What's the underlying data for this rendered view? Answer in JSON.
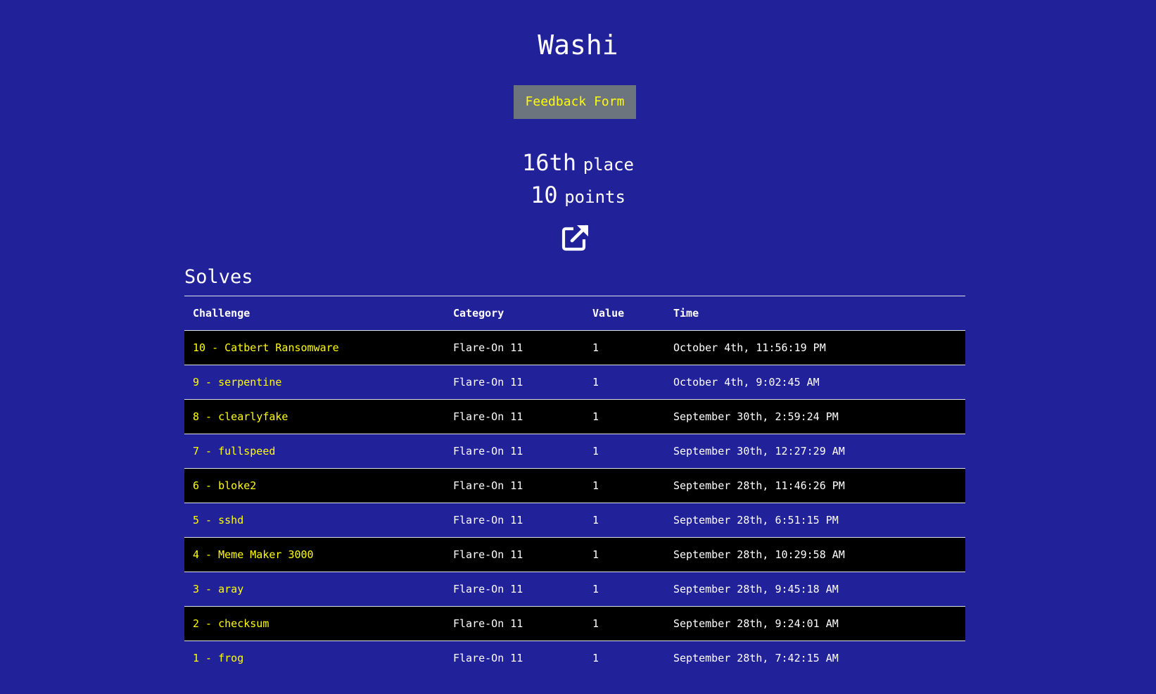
{
  "header": {
    "title": "Washi",
    "feedback_label": "Feedback Form"
  },
  "stats": {
    "place_value": "16th",
    "place_label": "place",
    "points_value": "10",
    "points_label": "points"
  },
  "icons": {
    "edit": "external-link-icon"
  },
  "solves": {
    "heading": "Solves",
    "columns": [
      "Challenge",
      "Category",
      "Value",
      "Time"
    ],
    "rows": [
      {
        "challenge": "10 - Catbert Ransomware",
        "category": "Flare-On 11",
        "value": "1",
        "time": "October 4th, 11:56:19 PM"
      },
      {
        "challenge": "9 - serpentine",
        "category": "Flare-On 11",
        "value": "1",
        "time": "October 4th, 9:02:45 AM"
      },
      {
        "challenge": "8 - clearlyfake",
        "category": "Flare-On 11",
        "value": "1",
        "time": "September 30th, 2:59:24 PM"
      },
      {
        "challenge": "7 - fullspeed",
        "category": "Flare-On 11",
        "value": "1",
        "time": "September 30th, 12:27:29 AM"
      },
      {
        "challenge": "6 - bloke2",
        "category": "Flare-On 11",
        "value": "1",
        "time": "September 28th, 11:46:26 PM"
      },
      {
        "challenge": "5 - sshd",
        "category": "Flare-On 11",
        "value": "1",
        "time": "September 28th, 6:51:15 PM"
      },
      {
        "challenge": "4 - Meme Maker 3000",
        "category": "Flare-On 11",
        "value": "1",
        "time": "September 28th, 10:29:58 AM"
      },
      {
        "challenge": "3 - aray",
        "category": "Flare-On 11",
        "value": "1",
        "time": "September 28th, 9:45:18 AM"
      },
      {
        "challenge": "2 - checksum",
        "category": "Flare-On 11",
        "value": "1",
        "time": "September 28th, 9:24:01 AM"
      },
      {
        "challenge": "1 - frog",
        "category": "Flare-On 11",
        "value": "1",
        "time": "September 28th, 7:42:15 AM"
      }
    ]
  },
  "colors": {
    "background": "#21219a",
    "link": "#ffff00",
    "button": "#6c757d",
    "striped_row": "#000000"
  }
}
